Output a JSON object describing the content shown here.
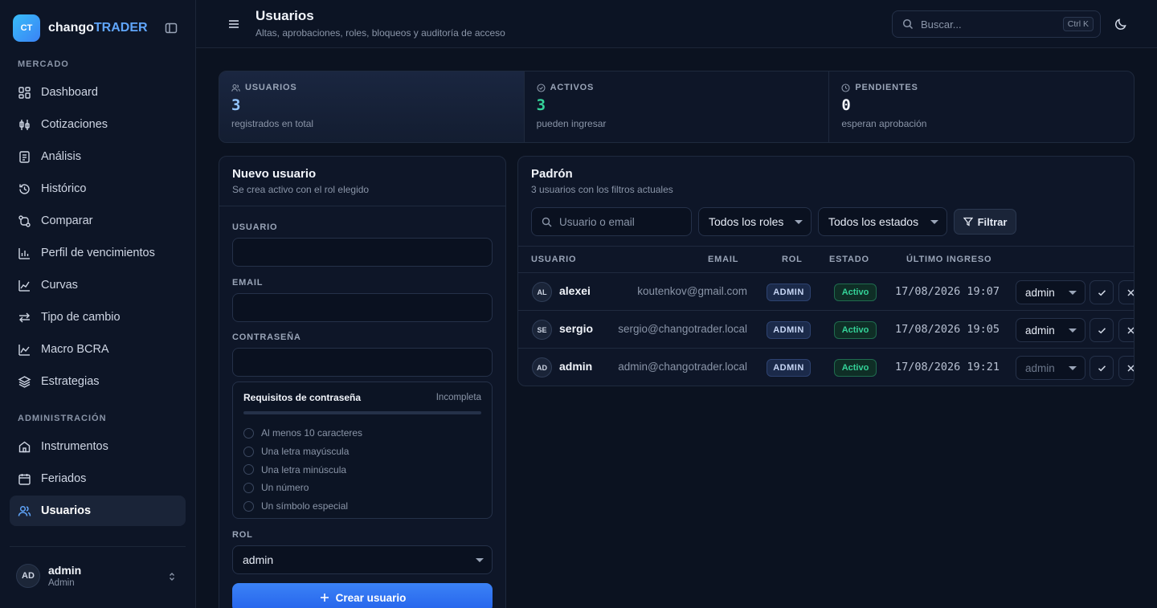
{
  "brand": {
    "logo": "CT",
    "name_a": "chango",
    "name_b": "TRADER"
  },
  "sidebar": {
    "sections": [
      {
        "title": "MERCADO"
      },
      {
        "title": "ADMINISTRACIÓN"
      }
    ],
    "items": [
      {
        "label": "Dashboard",
        "icon": "dashboard-icon"
      },
      {
        "label": "Cotizaciones",
        "icon": "quotes-icon"
      },
      {
        "label": "Análisis",
        "icon": "analysis-icon"
      },
      {
        "label": "Histórico",
        "icon": "history-icon"
      },
      {
        "label": "Comparar",
        "icon": "compare-icon"
      },
      {
        "label": "Perfil de vencimientos",
        "icon": "bar-chart-icon"
      },
      {
        "label": "Curvas",
        "icon": "curve-icon"
      },
      {
        "label": "Tipo de cambio",
        "icon": "exchange-icon"
      },
      {
        "label": "Macro BCRA",
        "icon": "line-chart-icon"
      },
      {
        "label": "Estrategias",
        "icon": "layers-icon"
      },
      {
        "label": "Instrumentos",
        "icon": "bank-icon"
      },
      {
        "label": "Feriados",
        "icon": "calendar-icon"
      },
      {
        "label": "Usuarios",
        "icon": "users-icon",
        "active": true
      }
    ],
    "user": {
      "initials": "AD",
      "name": "admin",
      "role": "Admin"
    }
  },
  "header": {
    "title": "Usuarios",
    "subtitle": "Altas, aprobaciones, roles, bloqueos y auditoría de acceso",
    "search_placeholder": "Buscar...",
    "shortcut": "Ctrl K"
  },
  "stats": [
    {
      "label": "USUARIOS",
      "value": "3",
      "desc": "registrados en total",
      "color": "#93c5fd"
    },
    {
      "label": "ACTIVOS",
      "value": "3",
      "desc": "pueden ingresar",
      "color": "#34d399"
    },
    {
      "label": "PENDIENTES",
      "value": "0",
      "desc": "esperan aprobación",
      "color": "#f2f5fb"
    }
  ],
  "new_user": {
    "title": "Nuevo usuario",
    "subtitle": "Se crea activo con el rol elegido",
    "fields": {
      "user": "USUARIO",
      "email": "EMAIL",
      "password": "CONTRASEÑA",
      "role": "ROL"
    },
    "requirements": {
      "title": "Requisitos de contraseña",
      "status": "Incompleta",
      "progress": 0,
      "items": [
        "Al menos 10 caracteres",
        "Una letra mayúscula",
        "Una letra minúscula",
        "Un número",
        "Un símbolo especial"
      ]
    },
    "role_value": "admin",
    "create_label": "Crear usuario"
  },
  "roster": {
    "title": "Padrón",
    "subtitle": "3 usuarios con los filtros actuales",
    "search_placeholder": "Usuario o email",
    "role_filter": "Todos los roles",
    "state_filter": "Todos los estados",
    "filter_label": "Filtrar",
    "columns": [
      "USUARIO",
      "EMAIL",
      "ROL",
      "ESTADO",
      "ÚLTIMO INGRESO"
    ],
    "rows": [
      {
        "initials": "AL",
        "name": "alexei",
        "email": "koutenkov@gmail.com",
        "role": "ADMIN",
        "state": "Activo",
        "last_login": "17/08/2026 19:07",
        "role_select": "admin"
      },
      {
        "initials": "SE",
        "name": "sergio",
        "email": "sergio@changotrader.local",
        "role": "ADMIN",
        "state": "Activo",
        "last_login": "17/08/2026 19:05",
        "role_select": "admin"
      },
      {
        "initials": "AD",
        "name": "admin",
        "email": "admin@changotrader.local",
        "role": "ADMIN",
        "state": "Activo",
        "last_login": "17/08/2026 19:21",
        "role_select": "admin"
      }
    ]
  }
}
